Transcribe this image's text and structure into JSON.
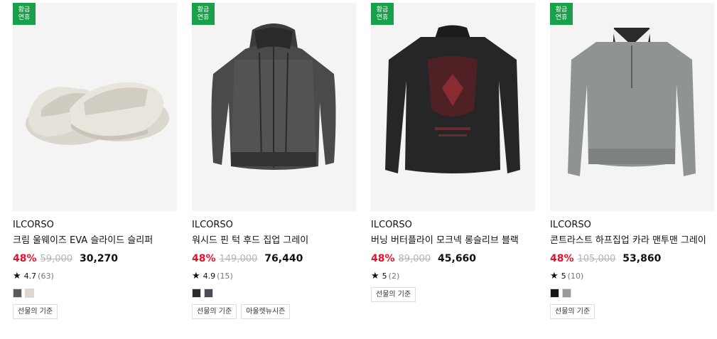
{
  "products": [
    {
      "badge": [
        "황금",
        "연휴"
      ],
      "brand": "ILCORSO",
      "title": "크림 울웨이즈 EVA 슬라이드 슬리퍼",
      "discount": "48%",
      "original_price": "59,000",
      "price": "30,270",
      "rating": "4.7",
      "reviews": "(63)",
      "swatches": [
        "#5a5a5a",
        "#dcd8cc"
      ],
      "tags": [
        "선물의 기준"
      ]
    },
    {
      "badge": [
        "황금",
        "연휴"
      ],
      "brand": "ILCORSO",
      "title": "워시드 핀 턱 후드 집업 그레이",
      "discount": "48%",
      "original_price": "149,000",
      "price": "76,440",
      "rating": "4.9",
      "reviews": "(15)",
      "swatches": [
        "#2a2a2a",
        "#4a4c55"
      ],
      "tags": [
        "선물의 기준",
        "아울렛뉴시즌"
      ]
    },
    {
      "badge": [
        "황금",
        "연휴"
      ],
      "brand": "ILCORSO",
      "title": "버닝 버터플라이 모크넥 롱슬리브 블랙",
      "discount": "48%",
      "original_price": "89,000",
      "price": "45,660",
      "rating": "5",
      "reviews": "(2)",
      "swatches": [],
      "tags": [
        "선물의 기준"
      ]
    },
    {
      "badge": [
        "황금",
        "연휴"
      ],
      "brand": "ILCORSO",
      "title": "콘트라스트 하프집업 카라 맨투맨 그레이",
      "discount": "48%",
      "original_price": "105,000",
      "price": "53,860",
      "rating": "5",
      "reviews": "(10)",
      "swatches": [
        "#151515",
        "#9a9a9a"
      ],
      "tags": [
        "선물의 기준"
      ]
    }
  ],
  "colors": {
    "badge_green": "#1aa04b",
    "discount_red": "#e4122b",
    "strike_gray": "#b5b5b5"
  }
}
